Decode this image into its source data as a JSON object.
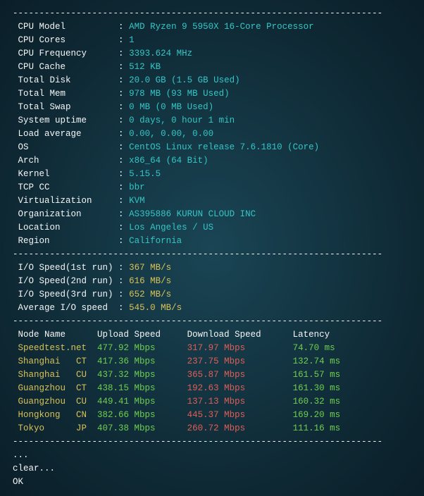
{
  "system": [
    {
      "label": "CPU Model          ",
      "value": "AMD Ryzen 9 5950X 16-Core Processor"
    },
    {
      "label": "CPU Cores          ",
      "value": "1"
    },
    {
      "label": "CPU Frequency      ",
      "value": "3393.624 MHz"
    },
    {
      "label": "CPU Cache          ",
      "value": "512 KB"
    },
    {
      "label": "Total Disk         ",
      "value": "20.0 GB (1.5 GB Used)"
    },
    {
      "label": "Total Mem          ",
      "value": "978 MB (93 MB Used)"
    },
    {
      "label": "Total Swap         ",
      "value": "0 MB (0 MB Used)"
    },
    {
      "label": "System uptime      ",
      "value": "0 days, 0 hour 1 min"
    },
    {
      "label": "Load average       ",
      "value": "0.00, 0.00, 0.00"
    },
    {
      "label": "OS                 ",
      "value": "CentOS Linux release 7.6.1810 (Core)"
    },
    {
      "label": "Arch               ",
      "value": "x86_64 (64 Bit)"
    },
    {
      "label": "Kernel             ",
      "value": "5.15.5"
    },
    {
      "label": "TCP CC             ",
      "value": "bbr"
    },
    {
      "label": "Virtualization     ",
      "value": "KVM"
    },
    {
      "label": "Organization       ",
      "value": "AS395886 KURUN CLOUD INC"
    },
    {
      "label": "Location           ",
      "value": "Los Angeles / US"
    },
    {
      "label": "Region             ",
      "value": "California"
    }
  ],
  "io": [
    {
      "label": "I/O Speed(1st run) ",
      "value": "367 MB/s"
    },
    {
      "label": "I/O Speed(2nd run) ",
      "value": "616 MB/s"
    },
    {
      "label": "I/O Speed(3rd run) ",
      "value": "652 MB/s"
    },
    {
      "label": "Average I/O speed  ",
      "value": "545.0 MB/s"
    }
  ],
  "speedHeader": {
    "node": "Node Name",
    "up": "Upload Speed",
    "down": "Download Speed",
    "lat": "Latency"
  },
  "speed": [
    {
      "node": "Speedtest.net  ",
      "up": "477.92 Mbps      ",
      "down": "317.97 Mbps         ",
      "lat": "74.70 ms"
    },
    {
      "node": "Shanghai   CT  ",
      "up": "417.36 Mbps      ",
      "down": "237.75 Mbps         ",
      "lat": "132.74 ms"
    },
    {
      "node": "Shanghai   CU  ",
      "up": "437.32 Mbps      ",
      "down": "365.87 Mbps         ",
      "lat": "161.57 ms"
    },
    {
      "node": "Guangzhou  CT  ",
      "up": "438.15 Mbps      ",
      "down": "192.63 Mbps         ",
      "lat": "161.30 ms"
    },
    {
      "node": "Guangzhou  CU  ",
      "up": "449.41 Mbps      ",
      "down": "137.13 Mbps         ",
      "lat": "160.32 ms"
    },
    {
      "node": "Hongkong   CN  ",
      "up": "382.66 Mbps      ",
      "down": "445.37 Mbps         ",
      "lat": "169.20 ms"
    },
    {
      "node": "Tokyo      JP  ",
      "up": "407.38 Mbps      ",
      "down": "260.72 Mbps         ",
      "lat": "111.16 ms"
    }
  ],
  "footer": {
    "dots": "...",
    "clear": "clear...",
    "ok": "OK"
  },
  "hr": "----------------------------------------------------------------------"
}
